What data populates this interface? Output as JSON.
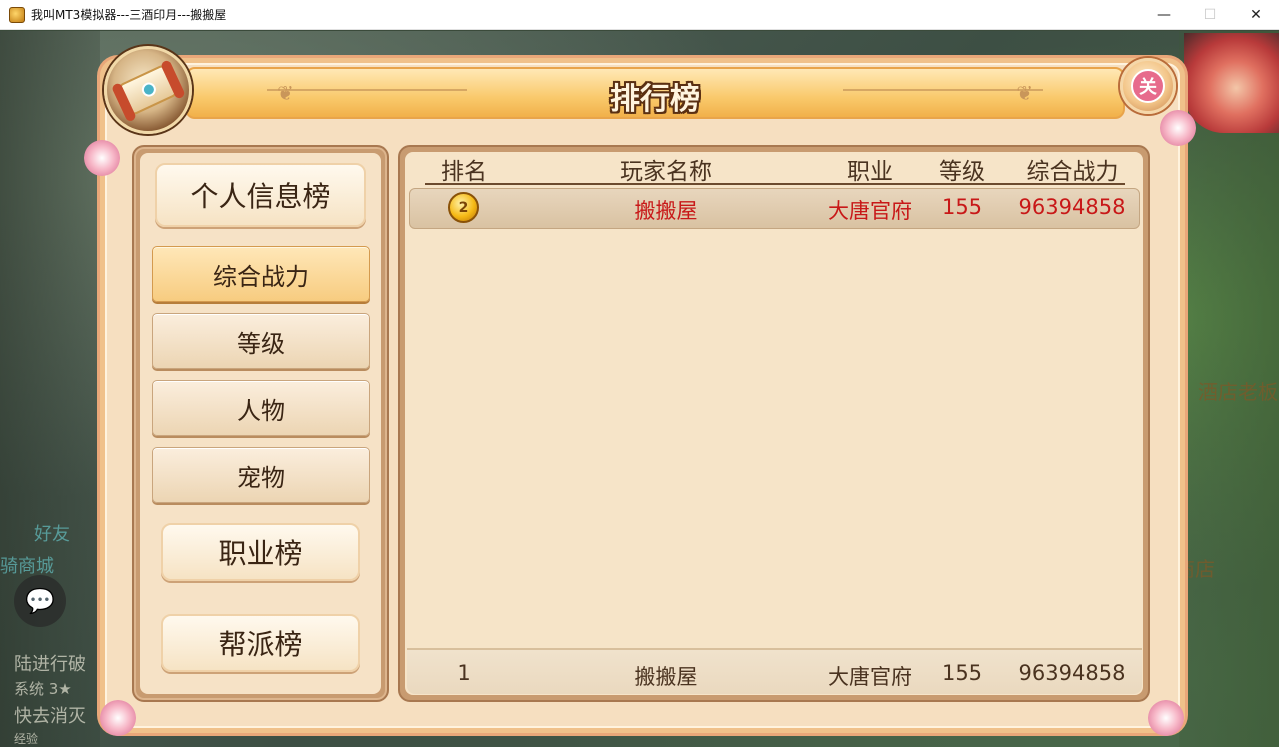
{
  "window": {
    "title": "我叫MT3模拟器---三酒印月---搬搬屋",
    "minimize": "—",
    "maximize": "☐",
    "close": "✕"
  },
  "background": {
    "npc_label_right": "酒店老板",
    "shop_label_right": "商店",
    "left_labels": [
      "好友",
      "骑商城"
    ],
    "chat_lines": [
      "陆进行破",
      "系统 3★",
      "快去消灭",
      "经验"
    ]
  },
  "panel": {
    "title": "排行榜",
    "close_icon_glyph": "关"
  },
  "nav": {
    "categories": [
      {
        "label": "个人信息榜"
      },
      {
        "label": "职业榜"
      },
      {
        "label": "帮派榜"
      }
    ],
    "sub_items": [
      {
        "label": "综合战力",
        "active": true
      },
      {
        "label": "等级",
        "active": false
      },
      {
        "label": "人物",
        "active": false
      },
      {
        "label": "宠物",
        "active": false
      }
    ]
  },
  "table": {
    "columns": [
      "排名",
      "玩家名称",
      "职业",
      "等级",
      "综合战力"
    ],
    "rows": [
      {
        "rank_icon": "gold-medal-icon",
        "name": "搬搬屋",
        "class": "大唐官府",
        "level": "155",
        "power": "96394858"
      }
    ],
    "self_row": {
      "rank": "1",
      "name": "搬搬屋",
      "class": "大唐官府",
      "level": "155",
      "power": "96394858"
    }
  },
  "colors": {
    "highlight_text": "#c81818",
    "panel_bg": "#f6dfc0",
    "header_gold": "#f9c96b"
  }
}
